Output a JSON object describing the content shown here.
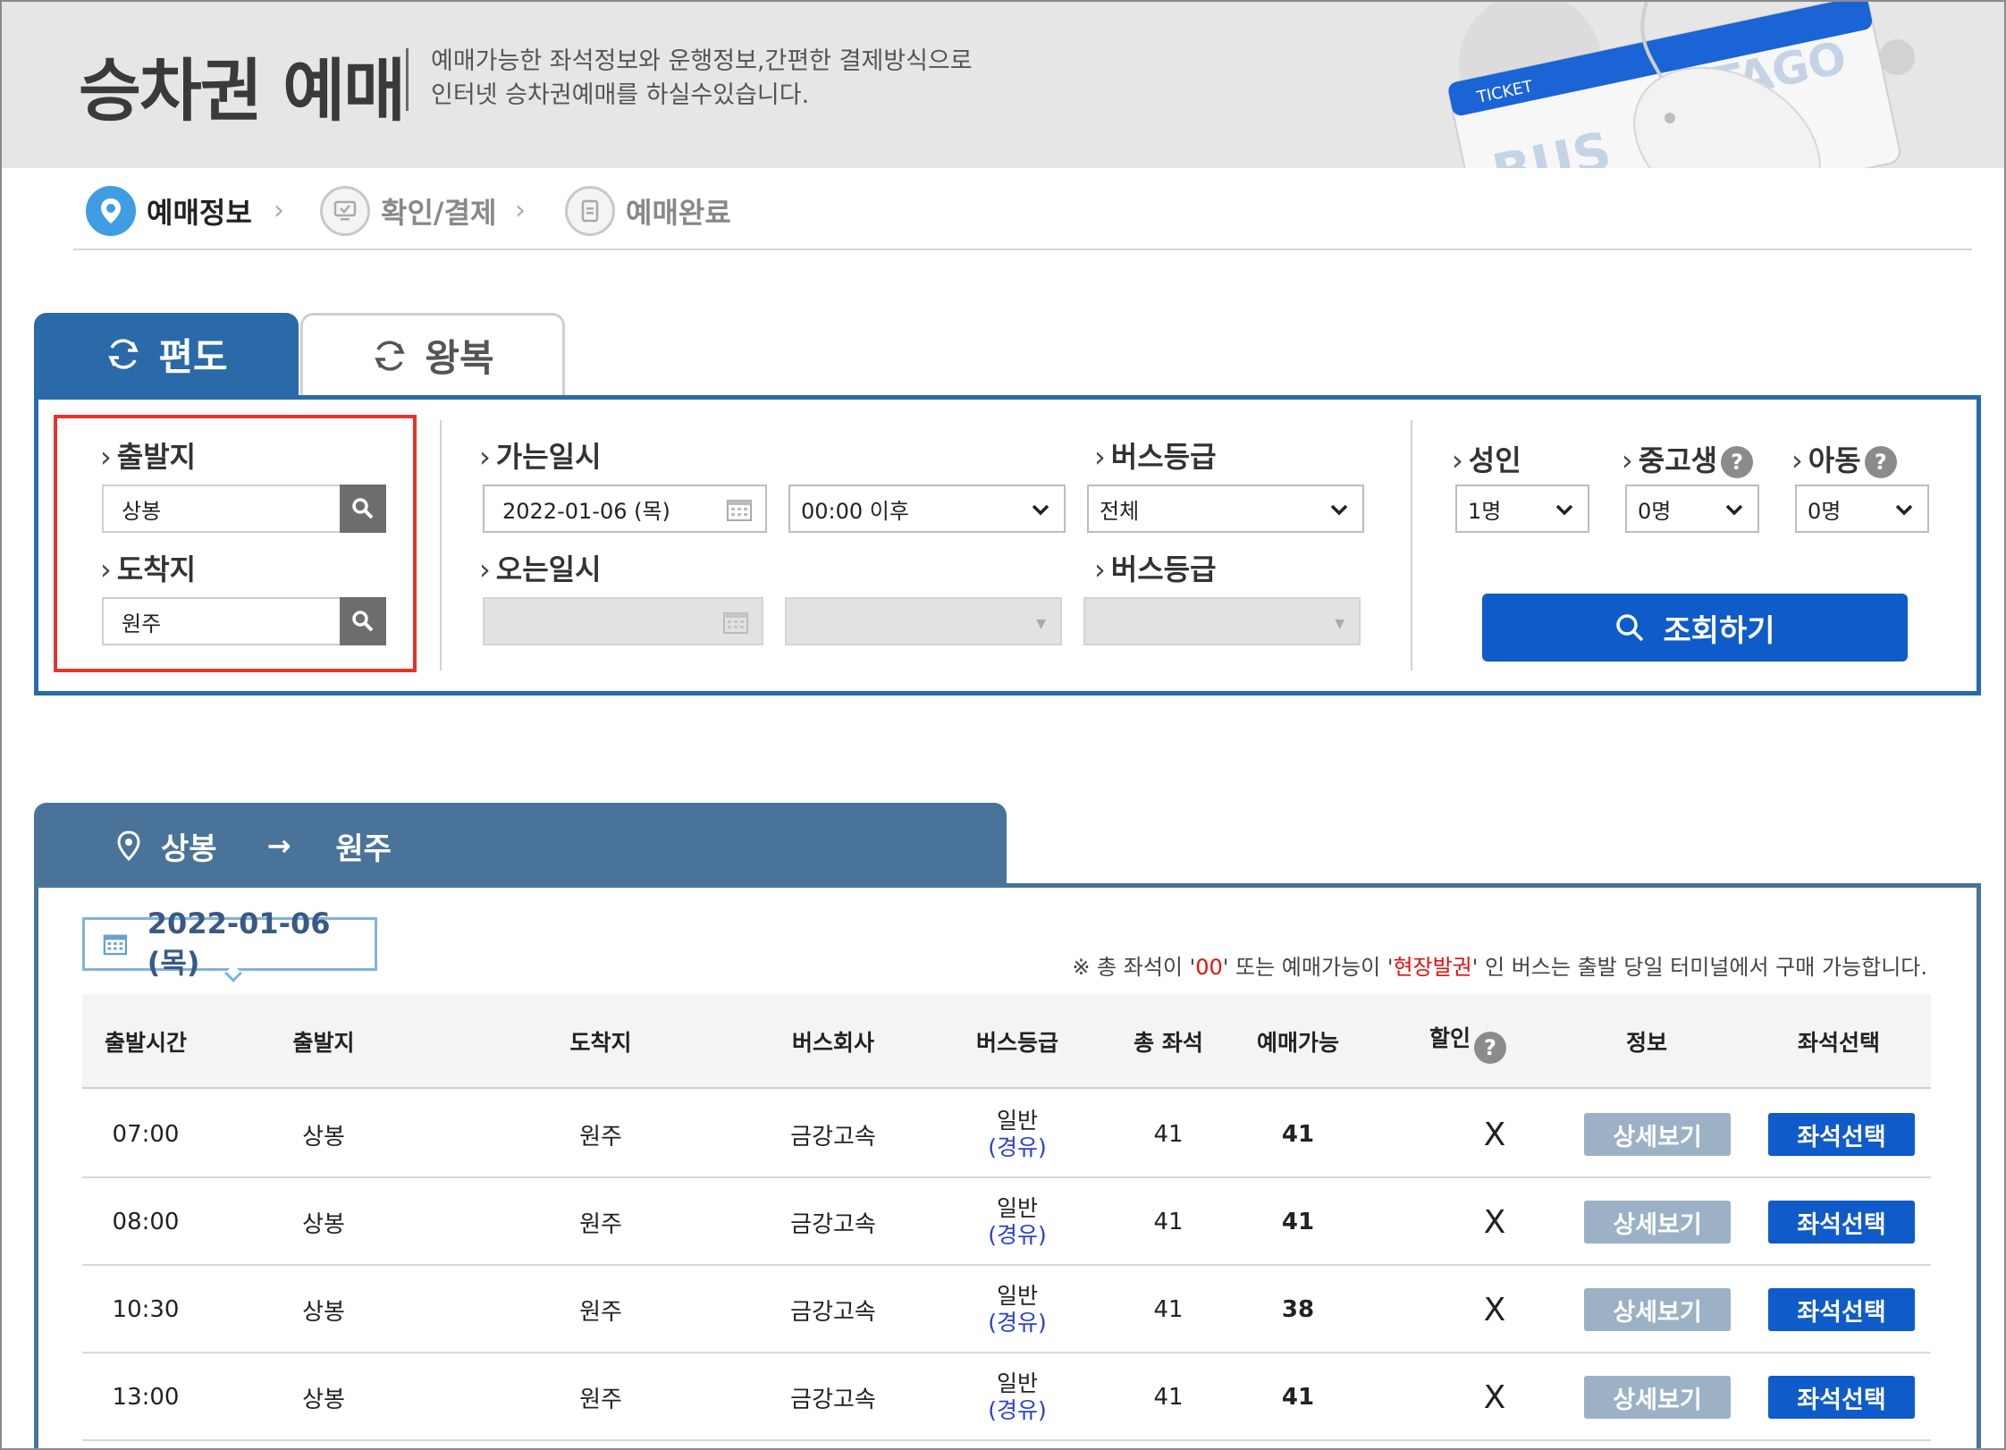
{
  "header": {
    "title": "승차권 예매",
    "desc_line1": "예매가능한 좌석정보와 운행정보,간편한 결제방식으로",
    "desc_line2": "인터넷 승차권예매를 하실수있습니다.",
    "art_ticket": "TICKET",
    "art_bus": "BUS",
    "art_tago": "TAGO"
  },
  "steps": [
    {
      "label": "예매정보",
      "active": true
    },
    {
      "label": "확인/결제",
      "active": false
    },
    {
      "label": "예매완료",
      "active": false
    }
  ],
  "tabs": {
    "oneway": "편도",
    "roundtrip": "왕복"
  },
  "search": {
    "departure_label": "출발지",
    "departure_value": "상봉",
    "arrival_label": "도착지",
    "arrival_value": "원주",
    "go_date_label": "가는일시",
    "go_date_value": "2022-01-06 (목)",
    "go_time_value": "00:00 이후",
    "bus_grade_label": "버스등급",
    "bus_grade_value": "전체",
    "return_date_label": "오는일시",
    "return_grade_label": "버스등급",
    "adult_label": "성인",
    "adult_value": "1명",
    "student_label": "중고생",
    "student_value": "0명",
    "child_label": "아동",
    "child_value": "0명",
    "help_glyph": "?",
    "query_button": "조회하기"
  },
  "route": {
    "from": "상봉",
    "arrow": "→",
    "to": "원주"
  },
  "results": {
    "date": "2022-01-06 (목)",
    "notice_prefix": "※ 총 좌석이 '",
    "notice_red1": "00",
    "notice_mid": "' 또는 예매가능이 '",
    "notice_red2": "현장발권",
    "notice_suffix": "' 인 버스는 출발 당일 터미널에서 구매 가능합니다.",
    "columns": {
      "dep_time": "출발시간",
      "origin": "출발지",
      "dest": "도착지",
      "company": "버스회사",
      "grade": "버스등급",
      "total": "총 좌석",
      "available": "예매가능",
      "discount": "할인",
      "info": "정보",
      "seat": "좌석선택"
    },
    "rows": [
      {
        "time": "07:00",
        "origin": "상봉",
        "dest": "원주",
        "company": "금강고속",
        "grade": "일반",
        "grade_via": "(경유)",
        "total": "41",
        "available": "41",
        "discount": "X",
        "detail": "상세보기",
        "seat": "좌석선택"
      },
      {
        "time": "08:00",
        "origin": "상봉",
        "dest": "원주",
        "company": "금강고속",
        "grade": "일반",
        "grade_via": "(경유)",
        "total": "41",
        "available": "41",
        "discount": "X",
        "detail": "상세보기",
        "seat": "좌석선택"
      },
      {
        "time": "10:30",
        "origin": "상봉",
        "dest": "원주",
        "company": "금강고속",
        "grade": "일반",
        "grade_via": "(경유)",
        "total": "41",
        "available": "38",
        "discount": "X",
        "detail": "상세보기",
        "seat": "좌석선택"
      },
      {
        "time": "13:00",
        "origin": "상봉",
        "dest": "원주",
        "company": "금강고속",
        "grade": "일반",
        "grade_via": "(경유)",
        "total": "41",
        "available": "41",
        "discount": "X",
        "detail": "상세보기",
        "seat": "좌석선택"
      }
    ]
  },
  "icons": {
    "step_location": "location-pin-icon",
    "step_confirm": "monitor-icon",
    "step_complete": "document-icon",
    "tab_refresh": "refresh-icon",
    "search": "magnifier-icon",
    "calendar": "calendar-icon",
    "dropdown": "chevron-down-icon",
    "help": "question-icon"
  },
  "colors": {
    "primary": "#2a6aa8",
    "button_blue": "#0f5bc9",
    "route_bar": "#4a7399",
    "highlight": "#e8332a",
    "notice_red": "#e4100e"
  }
}
